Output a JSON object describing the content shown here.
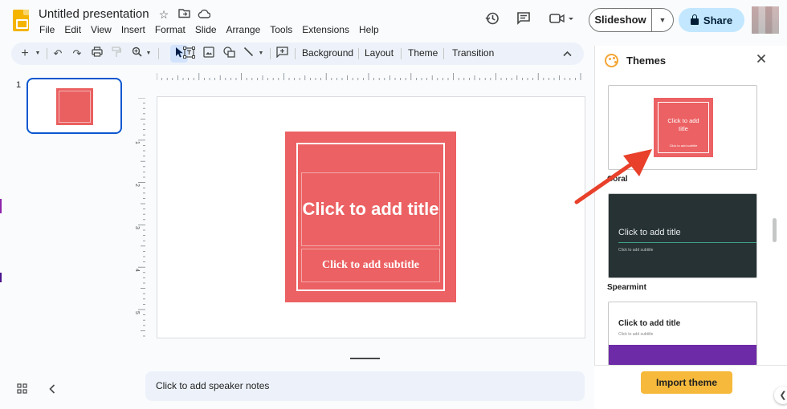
{
  "app": {
    "title": "Untitled presentation",
    "title_icons": [
      "star-icon",
      "move-to-folder-icon",
      "cloud-status-icon"
    ]
  },
  "menu": [
    "File",
    "Edit",
    "View",
    "Insert",
    "Format",
    "Slide",
    "Arrange",
    "Tools",
    "Extensions",
    "Help"
  ],
  "header": {
    "slideshow_label": "Slideshow",
    "share_label": "Share",
    "icons": [
      "version-history-icon",
      "comments-icon",
      "meet-icon"
    ]
  },
  "toolbar": {
    "background_label": "Background",
    "layout_label": "Layout",
    "theme_label": "Theme",
    "transition_label": "Transition"
  },
  "filmstrip": {
    "slide_number": "1"
  },
  "slide": {
    "title_placeholder": "Click to add title",
    "subtitle_placeholder": "Click to add subtitle",
    "color": "#ec6163"
  },
  "rulers": {
    "vertical_labels": [
      "1",
      "2",
      "3",
      "4",
      "5"
    ]
  },
  "notes": {
    "placeholder": "Click to add speaker notes"
  },
  "themes_panel": {
    "title": "Themes",
    "themes": [
      {
        "name": "Coral",
        "title": "Click to add title",
        "subtitle": "Click to add subtitle"
      },
      {
        "name": "Spearmint",
        "title": "Click to add title",
        "subtitle": "Click to add subtitle"
      },
      {
        "name": "",
        "title": "Click to add title",
        "subtitle": "Click to add subtitle"
      }
    ],
    "import_label": "Import theme"
  },
  "colors": {
    "accent_blue": "#0b57d0",
    "share_bg": "#c2e7ff",
    "import_bg": "#f6b93b",
    "arrow_red": "#e8402a"
  }
}
